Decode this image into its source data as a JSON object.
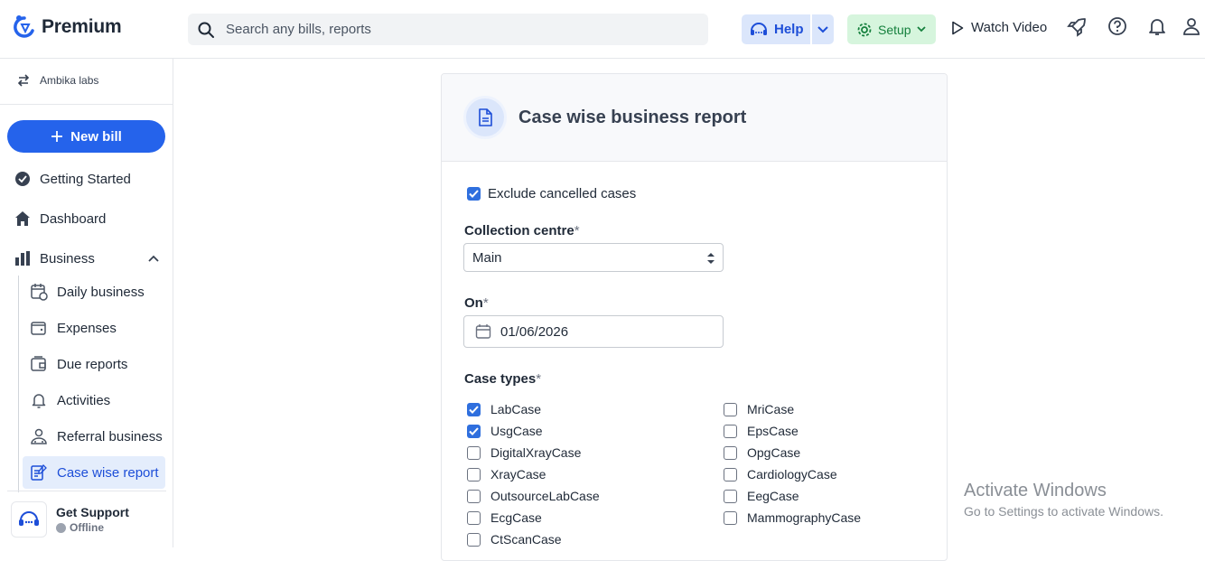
{
  "app": {
    "name": "Premium"
  },
  "search": {
    "placeholder": "Search any bills, reports"
  },
  "header": {
    "help_label": "Help",
    "setup_label": "Setup",
    "watch_video_label": "Watch Video"
  },
  "sidebar": {
    "org_name": "Ambika labs",
    "new_bill_label": "New bill",
    "nav": [
      {
        "label": "Getting Started",
        "icon": "check-circle-icon"
      },
      {
        "label": "Dashboard",
        "icon": "home-icon"
      },
      {
        "label": "Business",
        "icon": "bar-chart-icon"
      }
    ],
    "business_items": [
      {
        "label": "Daily business",
        "icon": "calendar-icon"
      },
      {
        "label": "Expenses",
        "icon": "wallet-icon"
      },
      {
        "label": "Due reports",
        "icon": "wallet-due-icon"
      },
      {
        "label": "Activities",
        "icon": "bell-icon"
      },
      {
        "label": "Referral business",
        "icon": "user-referral-icon"
      },
      {
        "label": "Case wise report",
        "icon": "report-icon",
        "active": true
      }
    ],
    "support": {
      "title": "Get Support",
      "status": "Offline"
    }
  },
  "report": {
    "title": "Case wise business report",
    "exclude_cancelled_label": "Exclude cancelled cases",
    "exclude_cancelled": true,
    "collection_centre_label": "Collection centre",
    "collection_centre_value": "Main",
    "on_label": "On",
    "on_value": "01/06/2026",
    "case_types_label": "Case types",
    "required_mark": "*",
    "case_types_left": [
      {
        "label": "LabCase",
        "checked": true
      },
      {
        "label": "UsgCase",
        "checked": true
      },
      {
        "label": "DigitalXrayCase",
        "checked": false
      },
      {
        "label": "XrayCase",
        "checked": false
      },
      {
        "label": "OutsourceLabCase",
        "checked": false
      },
      {
        "label": "EcgCase",
        "checked": false
      },
      {
        "label": "CtScanCase",
        "checked": false
      }
    ],
    "case_types_right": [
      {
        "label": "MriCase",
        "checked": false
      },
      {
        "label": "EpsCase",
        "checked": false
      },
      {
        "label": "OpgCase",
        "checked": false
      },
      {
        "label": "CardiologyCase",
        "checked": false
      },
      {
        "label": "EegCase",
        "checked": false
      },
      {
        "label": "MammographyCase",
        "checked": false
      }
    ]
  },
  "watermark": {
    "line1": "Activate Windows",
    "line2": "Go to Settings to activate Windows."
  },
  "colors": {
    "primary": "#2563eb",
    "help_bg": "#dbe6fb",
    "setup_bg": "#d6f5dd",
    "active_bg": "#e4edfc"
  }
}
